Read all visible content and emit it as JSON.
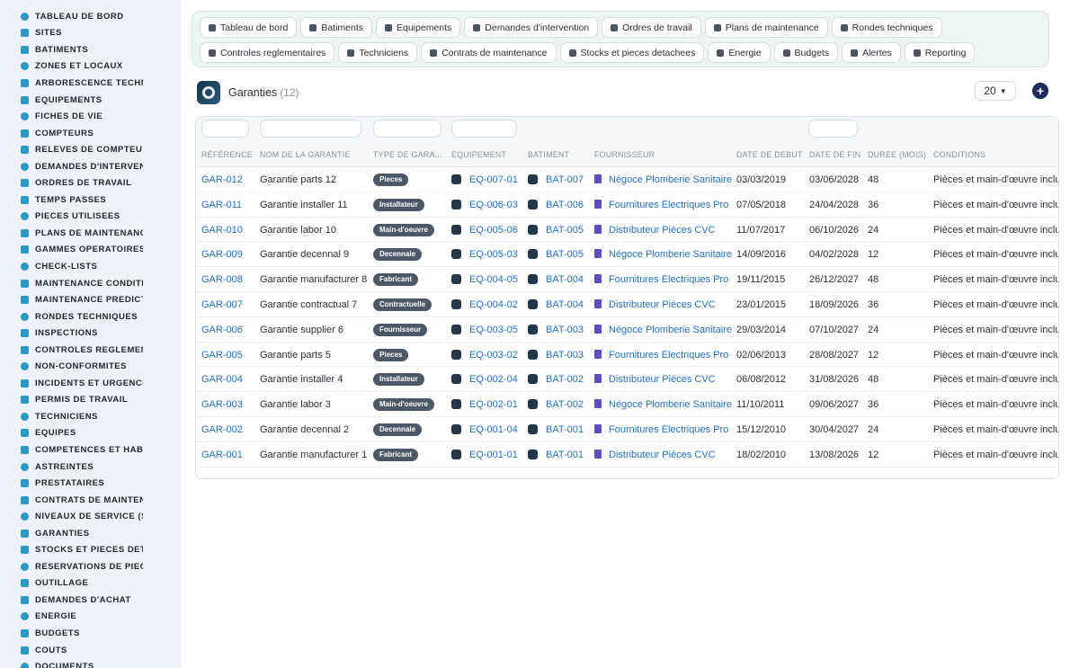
{
  "sidebar": {
    "items": [
      {
        "label": "TABLEAU DE BORD",
        "icon": "dashboard-icon"
      },
      {
        "label": "SITES",
        "icon": "map-pin-icon"
      },
      {
        "label": "BATIMENTS",
        "icon": "building-icon"
      },
      {
        "label": "ZONES ET LOCAUX",
        "icon": "zone-icon"
      },
      {
        "label": "ARBORESCENCE TECHNI",
        "icon": "tree-icon"
      },
      {
        "label": "EQUIPEMENTS",
        "icon": "gears-icon"
      },
      {
        "label": "FICHES DE VIE",
        "icon": "history-icon"
      },
      {
        "label": "COMPTEURS",
        "icon": "gauge-icon"
      },
      {
        "label": "RELEVES DE COMPTEUR!",
        "icon": "reading-icon"
      },
      {
        "label": "DEMANDES D'INTERVENT",
        "icon": "question-icon"
      },
      {
        "label": "ORDRES DE TRAVAIL",
        "icon": "clipboard-icon"
      },
      {
        "label": "TEMPS PASSES",
        "icon": "clock-icon"
      },
      {
        "label": "PIECES UTILISEES",
        "icon": "parts-icon"
      },
      {
        "label": "PLANS DE MAINTENANCE",
        "icon": "calendar-icon"
      },
      {
        "label": "GAMMES OPERATOIRES",
        "icon": "list-icon"
      },
      {
        "label": "CHECK-LISTS",
        "icon": "checklist-icon"
      },
      {
        "label": "MAINTENANCE CONDITIO",
        "icon": "thermometer-icon"
      },
      {
        "label": "MAINTENANCE PREDICTI",
        "icon": "chart-icon"
      },
      {
        "label": "RONDES TECHNIQUES",
        "icon": "route-icon"
      },
      {
        "label": "INSPECTIONS",
        "icon": "search-icon"
      },
      {
        "label": "CONTROLES REGLEMENT",
        "icon": "clipboard-check-icon"
      },
      {
        "label": "NON-CONFORMITES",
        "icon": "alert-circle-icon"
      },
      {
        "label": "INCIDENTS ET URGENCE!",
        "icon": "warning-icon"
      },
      {
        "label": "PERMIS DE TRAVAIL",
        "icon": "permit-icon"
      },
      {
        "label": "TECHNICIENS",
        "icon": "helmet-icon"
      },
      {
        "label": "EQUIPES",
        "icon": "users-icon"
      },
      {
        "label": "COMPETENCES ET HABIL",
        "icon": "certificate-icon"
      },
      {
        "label": "ASTREINTES",
        "icon": "phone-icon"
      },
      {
        "label": "PRESTATAIRES",
        "icon": "handshake-icon"
      },
      {
        "label": "CONTRATS DE MAINTENA",
        "icon": "contract-icon"
      },
      {
        "label": "NIVEAUX DE SERVICE (SL",
        "icon": "stopwatch-icon"
      },
      {
        "label": "GARANTIES",
        "icon": "shield-icon"
      },
      {
        "label": "STOCKS ET PIECES DETA",
        "icon": "boxes-icon"
      },
      {
        "label": "RESERVATIONS DE PIECE",
        "icon": "bookmark-icon"
      },
      {
        "label": "OUTILLAGE",
        "icon": "tools-icon"
      },
      {
        "label": "DEMANDES D'ACHAT",
        "icon": "cart-icon"
      },
      {
        "label": "ENERGIE",
        "icon": "bolt-icon"
      },
      {
        "label": "BUDGETS",
        "icon": "money-icon"
      },
      {
        "label": "COUTS",
        "icon": "coins-icon"
      },
      {
        "label": "DOCUMENTS",
        "icon": "document-icon"
      }
    ]
  },
  "topnav": {
    "items": [
      {
        "label": "Tableau de bord",
        "icon": "dashboard-icon"
      },
      {
        "label": "Batiments",
        "icon": "building-icon"
      },
      {
        "label": "Equipements",
        "icon": "gears-icon"
      },
      {
        "label": "Demandes d'intervention",
        "icon": "question-icon"
      },
      {
        "label": "Ordres de travail",
        "icon": "clipboard-icon"
      },
      {
        "label": "Plans de maintenance",
        "icon": "calendar-icon"
      },
      {
        "label": "Rondes techniques",
        "icon": "route-icon"
      },
      {
        "label": "Controles reglementaires",
        "icon": "clipboard-check-icon"
      },
      {
        "label": "Techniciens",
        "icon": "helmet-icon"
      },
      {
        "label": "Contrats de maintenance",
        "icon": "contract-icon"
      },
      {
        "label": "Stocks et pieces detachees",
        "icon": "boxes-icon"
      },
      {
        "label": "Energie",
        "icon": "bolt-icon"
      },
      {
        "label": "Budgets",
        "icon": "money-icon"
      },
      {
        "label": "Alertes",
        "icon": "bell-icon"
      },
      {
        "label": "Reporting",
        "icon": "pie-chart-icon"
      }
    ]
  },
  "header": {
    "title": "Garanties",
    "count": "(12)",
    "page_size": "20",
    "add_label": "+"
  },
  "table": {
    "columns": [
      "RÉFÉRENCE",
      "NOM DE LA GARANTIE",
      "TYPE DE GARA...",
      "EQUIPEMENT",
      "BATIMENT",
      "FOURNISSEUR",
      "DATE DE DEBUT",
      "DATE DE FIN",
      "DUREE (MOIS)",
      "CONDITIONS"
    ],
    "rows": [
      [
        "GAR-012",
        "Garantie parts 12",
        "Pieces",
        "EQ-007-01",
        "BAT-007",
        "Négoce Plomberie Sanitaire",
        "03/03/2019",
        "03/06/2028",
        "48",
        "Pièces et main-d'œuvre inclu..."
      ],
      [
        "GAR-011",
        "Garantie installer 11",
        "Installateur",
        "EQ-006-03",
        "BAT-006",
        "Fournitures Électriques Pro",
        "07/05/2018",
        "24/04/2028",
        "36",
        "Pièces et main-d'œuvre inclu..."
      ],
      [
        "GAR-010",
        "Garantie labor 10",
        "Main-d'oeuvre",
        "EQ-005-06",
        "BAT-005",
        "Distributeur Pièces CVC",
        "11/07/2017",
        "06/10/2026",
        "24",
        "Pièces et main-d'œuvre inclu..."
      ],
      [
        "GAR-009",
        "Garantie decennal 9",
        "Decennale",
        "EQ-005-03",
        "BAT-005",
        "Négoce Plomberie Sanitaire",
        "14/09/2016",
        "04/02/2028",
        "12",
        "Pièces et main-d'œuvre inclu..."
      ],
      [
        "GAR-008",
        "Garantie manufacturer 8",
        "Fabricant",
        "EQ-004-05",
        "BAT-004",
        "Fournitures Électriques Pro",
        "19/11/2015",
        "26/12/2027",
        "48",
        "Pièces et main-d'œuvre inclu..."
      ],
      [
        "GAR-007",
        "Garantie contractual 7",
        "Contractuelle",
        "EQ-004-02",
        "BAT-004",
        "Distributeur Pièces CVC",
        "23/01/2015",
        "18/09/2026",
        "36",
        "Pièces et main-d'œuvre inclu..."
      ],
      [
        "GAR-006",
        "Garantie supplier 6",
        "Fournisseur",
        "EQ-003-05",
        "BAT-003",
        "Négoce Plomberie Sanitaire",
        "29/03/2014",
        "07/10/2027",
        "24",
        "Pièces et main-d'œuvre inclu..."
      ],
      [
        "GAR-005",
        "Garantie parts 5",
        "Pieces",
        "EQ-003-02",
        "BAT-003",
        "Fournitures Électriques Pro",
        "02/06/2013",
        "28/08/2027",
        "12",
        "Pièces et main-d'œuvre inclu..."
      ],
      [
        "GAR-004",
        "Garantie installer 4",
        "Installateur",
        "EQ-002-04",
        "BAT-002",
        "Distributeur Pièces CVC",
        "06/08/2012",
        "31/08/2026",
        "48",
        "Pièces et main-d'œuvre inclu..."
      ],
      [
        "GAR-003",
        "Garantie labor 3",
        "Main-d'oeuvre",
        "EQ-002-01",
        "BAT-002",
        "Négoce Plomberie Sanitaire",
        "11/10/2011",
        "09/06/2027",
        "36",
        "Pièces et main-d'œuvre inclu..."
      ],
      [
        "GAR-002",
        "Garantie decennal 2",
        "Decennale",
        "EQ-001-04",
        "BAT-001",
        "Fournitures Électriques Pro",
        "15/12/2010",
        "30/04/2027",
        "24",
        "Pièces et main-d'œuvre inclu..."
      ],
      [
        "GAR-001",
        "Garantie manufacturer 1",
        "Fabricant",
        "EQ-001-01",
        "BAT-001",
        "Distributeur Pièces CVC",
        "18/02/2010",
        "13/08/2026",
        "12",
        "Pièces et main-d'œuvre inclu..."
      ]
    ]
  },
  "colors": {
    "accent": "#2a9ac4",
    "link": "#1f6fc8",
    "badge": "#4d5866",
    "add_button": "#1e2b5a"
  }
}
